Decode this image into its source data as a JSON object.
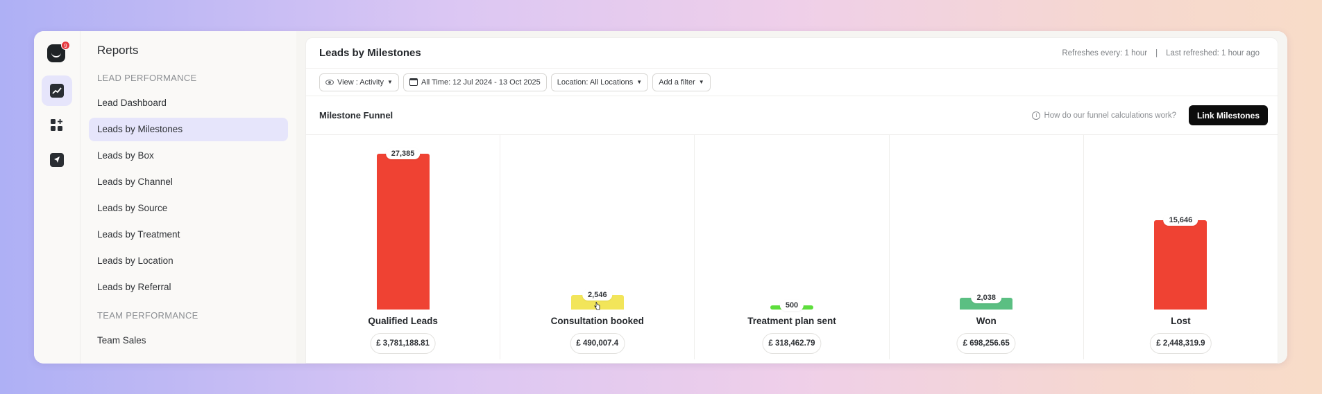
{
  "rail": {
    "badge_count": "9",
    "icons": [
      "chart-icon",
      "apps-add-icon",
      "send-icon"
    ]
  },
  "sidebar": {
    "title": "Reports",
    "lead_section": "LEAD PERFORMANCE",
    "lead_items": [
      {
        "label": "Lead Dashboard"
      },
      {
        "label": "Leads by Milestones",
        "active": true
      },
      {
        "label": "Leads by Box"
      },
      {
        "label": "Leads by Channel"
      },
      {
        "label": "Leads by Source"
      },
      {
        "label": "Leads by Treatment"
      },
      {
        "label": "Leads by Location"
      },
      {
        "label": "Leads by Referral"
      }
    ],
    "team_section": "TEAM PERFORMANCE",
    "team_items": [
      {
        "label": "Team Sales"
      }
    ]
  },
  "header": {
    "title": "Leads by Milestones",
    "refresh_every": "Refreshes every: 1 hour",
    "separator": "|",
    "last_refreshed": "Last refreshed: 1 hour ago"
  },
  "filters": {
    "view": "View : Activity",
    "date_range": "All Time: 12 Jul 2024 - 13 Oct 2025",
    "location": "Location: All Locations",
    "add_filter": "Add a filter"
  },
  "funnel": {
    "title": "Milestone Funnel",
    "help_text": "How do our funnel calculations work?",
    "link_button": "Link Milestones",
    "max_value": 27385,
    "colors": {
      "red": "#ef4233",
      "yellow": "#f2e55a",
      "green": "#5dde3c",
      "teal": "#5bbf82"
    },
    "stages": [
      {
        "name": "Qualified Leads",
        "count": 27385,
        "count_label": "27,385",
        "value": "£ 3,781,188.81",
        "color": "#ef4233"
      },
      {
        "name": "Consultation booked",
        "count": 2546,
        "count_label": "2,546",
        "value": "£ 490,007.4",
        "color": "#f2e55a"
      },
      {
        "name": "Treatment plan sent",
        "count": 500,
        "count_label": "500",
        "value": "£ 318,462.79",
        "color": "#5dde3c"
      },
      {
        "name": "Won",
        "count": 2038,
        "count_label": "2,038",
        "value": "£ 698,256.65",
        "color": "#5bbf82"
      },
      {
        "name": "Lost",
        "count": 15646,
        "count_label": "15,646",
        "value": "£ 2,448,319.9",
        "color": "#ef4233"
      }
    ]
  }
}
